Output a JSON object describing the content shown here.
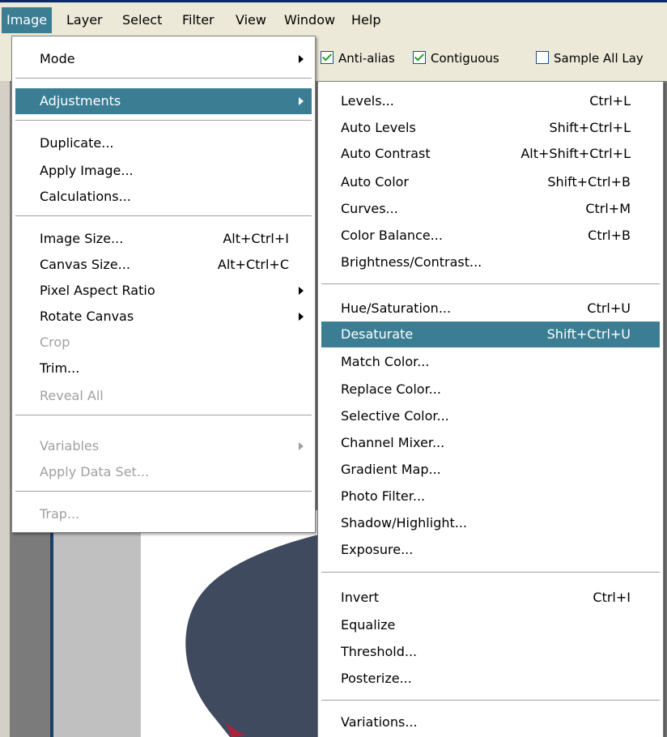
{
  "menubar": {
    "items": [
      "Image",
      "Layer",
      "Select",
      "Filter",
      "View",
      "Window",
      "Help"
    ],
    "active": "Image"
  },
  "options_bar": {
    "anti_alias": {
      "label": "Anti-alias",
      "checked": true
    },
    "contiguous": {
      "label": "Contiguous",
      "checked": true
    },
    "sample_all_layers": {
      "label": "Sample All Lay",
      "checked": false
    }
  },
  "image_menu": {
    "mode": "Mode",
    "adjustments": "Adjustments",
    "duplicate": "Duplicate...",
    "apply_image": "Apply Image...",
    "calculations": "Calculations...",
    "image_size": {
      "label": "Image Size...",
      "shortcut": "Alt+Ctrl+I"
    },
    "canvas_size": {
      "label": "Canvas Size...",
      "shortcut": "Alt+Ctrl+C"
    },
    "pixel_aspect_ratio": "Pixel Aspect Ratio",
    "rotate_canvas": "Rotate Canvas",
    "crop": "Crop",
    "trim": "Trim...",
    "reveal_all": "Reveal All",
    "variables": "Variables",
    "apply_data_set": "Apply Data Set...",
    "trap": "Trap..."
  },
  "adjustments_menu": {
    "levels": {
      "label": "Levels...",
      "shortcut": "Ctrl+L"
    },
    "auto_levels": {
      "label": "Auto Levels",
      "shortcut": "Shift+Ctrl+L"
    },
    "auto_contrast": {
      "label": "Auto Contrast",
      "shortcut": "Alt+Shift+Ctrl+L"
    },
    "auto_color": {
      "label": "Auto Color",
      "shortcut": "Shift+Ctrl+B"
    },
    "curves": {
      "label": "Curves...",
      "shortcut": "Ctrl+M"
    },
    "color_balance": {
      "label": "Color Balance...",
      "shortcut": "Ctrl+B"
    },
    "brightness_contrast": {
      "label": "Brightness/Contrast..."
    },
    "hue_saturation": {
      "label": "Hue/Saturation...",
      "shortcut": "Ctrl+U"
    },
    "desaturate": {
      "label": "Desaturate",
      "shortcut": "Shift+Ctrl+U"
    },
    "match_color": {
      "label": "Match Color..."
    },
    "replace_color": {
      "label": "Replace Color..."
    },
    "selective_color": {
      "label": "Selective Color..."
    },
    "channel_mixer": {
      "label": "Channel Mixer..."
    },
    "gradient_map": {
      "label": "Gradient Map..."
    },
    "photo_filter": {
      "label": "Photo Filter..."
    },
    "shadow_highlight": {
      "label": "Shadow/Highlight..."
    },
    "exposure": {
      "label": "Exposure..."
    },
    "invert": {
      "label": "Invert",
      "shortcut": "Ctrl+I"
    },
    "equalize": {
      "label": "Equalize"
    },
    "threshold": {
      "label": "Threshold..."
    },
    "posterize": {
      "label": "Posterize..."
    },
    "variations": {
      "label": "Variations..."
    }
  },
  "colors": {
    "highlight": "#3b7e94",
    "menubar_bg": "#ece9d8",
    "disabled_text": "#a0a0a0"
  }
}
